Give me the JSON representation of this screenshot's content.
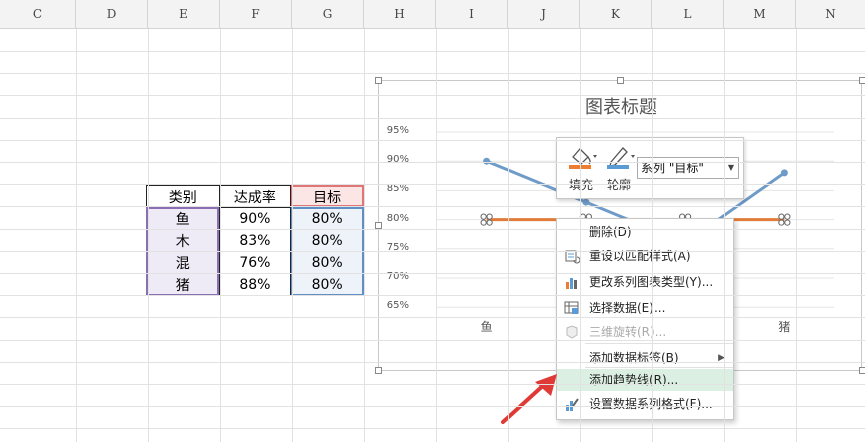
{
  "columns": [
    "C",
    "D",
    "E",
    "F",
    "G",
    "H",
    "I",
    "J",
    "K",
    "L",
    "M",
    "N"
  ],
  "table": {
    "headers": [
      "类别",
      "达成率",
      "目标"
    ],
    "rows": [
      [
        "鱼",
        "90%",
        "80%"
      ],
      [
        "木",
        "83%",
        "80%"
      ],
      [
        "混",
        "76%",
        "80%"
      ],
      [
        "猪",
        "88%",
        "80%"
      ]
    ]
  },
  "chart_data": {
    "type": "line",
    "title": "图表标题",
    "yticks": [
      "95%",
      "90%",
      "85%",
      "80%",
      "75%",
      "70%",
      "65%"
    ],
    "categories": [
      "鱼",
      "木",
      "混",
      "猪"
    ],
    "visible_x_labels": [
      "鱼",
      "猪"
    ],
    "ylim": [
      0.65,
      0.95
    ],
    "series": [
      {
        "values": [
          0.9,
          0.83,
          0.76,
          0.88
        ],
        "color": "#6e9bc8"
      },
      {
        "name": "目标",
        "values": [
          0.8,
          0.8,
          0.8,
          0.8
        ],
        "color": "#e07b39"
      }
    ]
  },
  "toolbar": {
    "fill_label": "填充",
    "outline_label": "轮廓",
    "series_select": "系列 \"目标\"",
    "fill_color": "#ed7d31",
    "outline_color": "#5b9bd5"
  },
  "context_menu": {
    "items": [
      {
        "label": "删除(D)",
        "icon": "",
        "enabled": true
      },
      {
        "label": "重设以匹配样式(A)",
        "icon": "reset-style-icon",
        "enabled": true
      },
      {
        "label": "更改系列图表类型(Y)...",
        "icon": "bar-chart-icon",
        "enabled": true
      },
      {
        "label": "选择数据(E)...",
        "icon": "select-data-icon",
        "enabled": true
      },
      {
        "label": "三维旋转(R)...",
        "icon": "rotate-3d-icon",
        "enabled": false
      },
      {
        "label": "添加数据标签(B)",
        "icon": "",
        "enabled": true,
        "submenu": true
      },
      {
        "label": "添加趋势线(R)...",
        "icon": "",
        "enabled": true,
        "highlighted": true
      },
      {
        "label": "设置数据系列格式(F)...",
        "icon": "format-series-icon",
        "enabled": true
      }
    ]
  },
  "highlight_color": "#dcefe3",
  "arrow_color": "#e03a36"
}
